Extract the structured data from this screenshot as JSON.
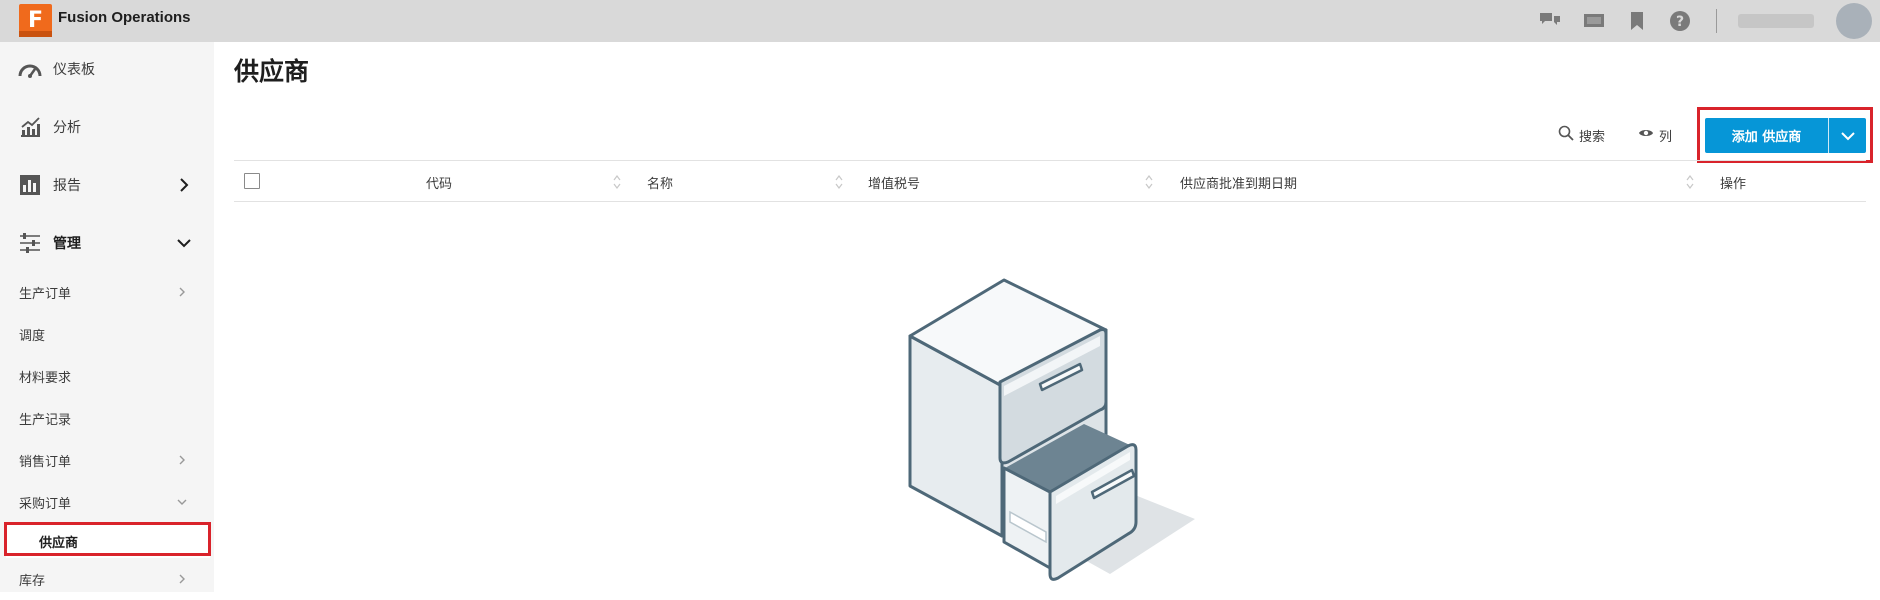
{
  "app": {
    "logo_letter": "F",
    "title": "Fusion Operations"
  },
  "topbar": {
    "icons": [
      "chat-icon",
      "screen-icon",
      "bookmark-icon",
      "help-icon"
    ],
    "user_name": ""
  },
  "sidebar": {
    "main_items": [
      {
        "label": "仪表板",
        "icon": "dashboard-icon"
      },
      {
        "label": "分析",
        "icon": "analytics-icon"
      },
      {
        "label": "报告",
        "icon": "report-icon"
      },
      {
        "label": "管理",
        "icon": "sliders-icon"
      }
    ],
    "sub_items": [
      {
        "label": "生产订单"
      },
      {
        "label": "调度"
      },
      {
        "label": "材料要求"
      },
      {
        "label": "生产记录"
      },
      {
        "label": "销售订单"
      },
      {
        "label": "采购订单"
      },
      {
        "label": "供应商"
      },
      {
        "label": "库存"
      }
    ]
  },
  "main": {
    "title": "供应商",
    "search_label": "搜索",
    "columns_label": "列",
    "add_button_label": "添加 供应商"
  },
  "table": {
    "headers": [
      "代码",
      "名称",
      "增值税号",
      "供应商批准到期日期",
      "操作"
    ]
  },
  "colors": {
    "accent": "#0696d7",
    "logo": "#f06a1c",
    "highlight": "#d9232b"
  }
}
